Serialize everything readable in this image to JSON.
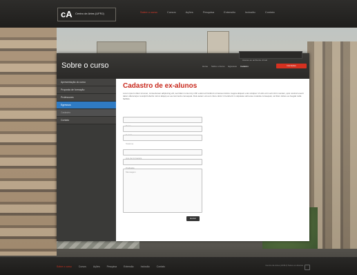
{
  "site": {
    "logo_mark": "cA",
    "logo_text": "Centro de Artes (UFRJ)"
  },
  "top_nav": {
    "items": [
      "Sobre o curso",
      "Cursos",
      "Ações",
      "Pesquisa",
      "Extensão",
      "Inclusão",
      "Contato"
    ],
    "active_index": 0
  },
  "panel": {
    "title": "Sobre o curso",
    "mini_label": "Acesso ao ambiente virtual",
    "breadcrumb": [
      "Home",
      "Sobre o Curso",
      "Egressos",
      "Cadastro"
    ],
    "cta_label": "Inscrições"
  },
  "sidebar": {
    "items": [
      {
        "label": "Apresentação do curso",
        "state": "normal"
      },
      {
        "label": "Proposta de formação",
        "state": "normal"
      },
      {
        "label": "Professores",
        "state": "normal"
      },
      {
        "label": "Egressos",
        "state": "active"
      },
      {
        "label": "Cadastro",
        "state": "sub"
      },
      {
        "label": "Contato",
        "state": "normal"
      }
    ]
  },
  "form": {
    "title": "Cadastro de ex-alunos",
    "intro": "Lorem ipsum dolor sit amet, consectetuer adipiscing elit, sed diam nonummy nibh euismod tincidunt ut laoreet dolore magna aliquam erat volutpat. Ut wisi enim ad minim veniam, quis nostrud exerci tation ullamcorper suscipit lobortis nisl ut aliquip ex ea commodo consequat. Duis autem vel eum iriure dolor in hendrerit in vulputate velit esse molestie consequat, vel illum dolore eu feugiat nulla facilisis.",
    "fields": [
      {
        "placeholder": "Nome"
      },
      {
        "placeholder": "E-mail"
      },
      {
        "placeholder": "Telefone"
      },
      {
        "placeholder": "Ano de formatura"
      },
      {
        "placeholder": "Profissão"
      }
    ],
    "message_placeholder": "Mensagem",
    "submit_label": "Enviar"
  },
  "footer": {
    "nav": [
      "Sobre o curso",
      "Cursos",
      "Ações",
      "Pesquisa",
      "Extensão",
      "Inclusão",
      "Contato"
    ],
    "active_index": 0,
    "meta": "Centro de Artes (UFRJ) Todos os direitos"
  },
  "colors": {
    "accent_red": "#d63120",
    "active_blue": "#2f7bc4",
    "title_red": "#c8281c"
  }
}
